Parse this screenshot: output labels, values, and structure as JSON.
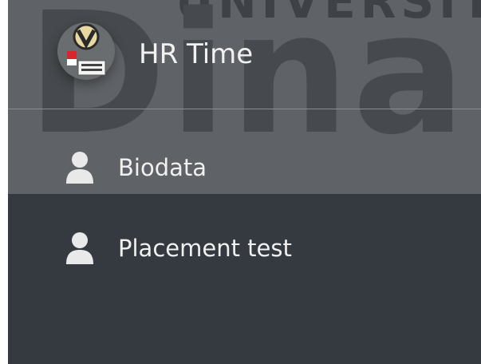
{
  "watermark": {
    "top_text": "UNIVERSITAS",
    "big_text": "Dinamika"
  },
  "brand": {
    "title": "HR Time",
    "logo_icon": "university-crest-icon"
  },
  "nav": {
    "items": [
      {
        "label": "Biodata",
        "icon": "user-icon",
        "active": true
      },
      {
        "label": "Placement test",
        "icon": "user-icon",
        "active": false
      }
    ]
  },
  "colors": {
    "sidebar_bg": "#343a40",
    "highlight_bg": "#5f6266",
    "text": "#f0f0f0",
    "icon": "#e9e9e9"
  }
}
